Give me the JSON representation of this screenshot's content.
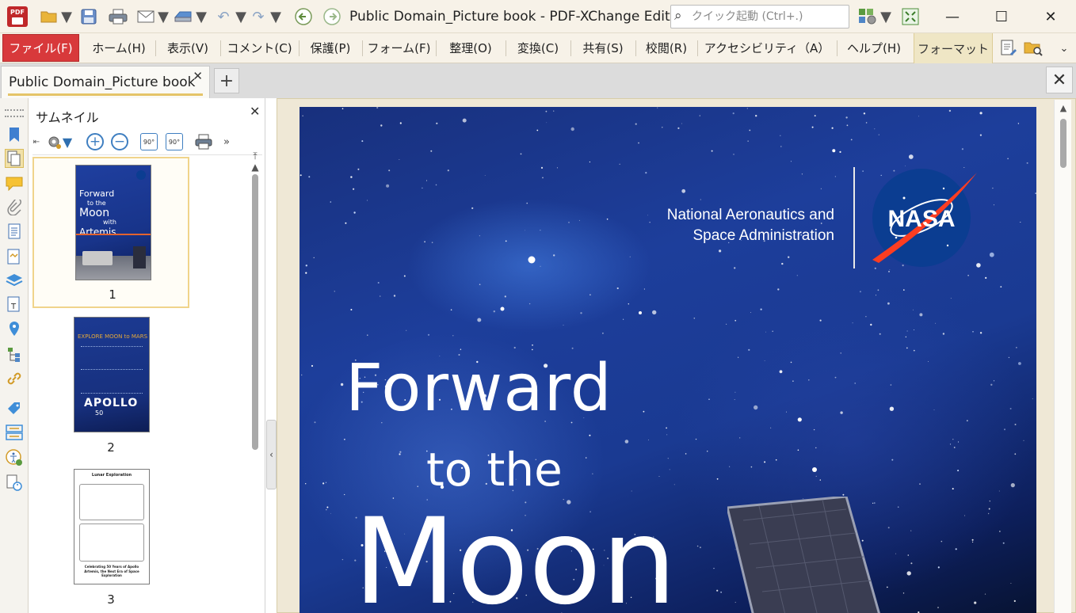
{
  "window": {
    "title": "Public Domain_Picture book - PDF-XChange Editor",
    "quick_launch_placeholder": "クイック起動 (Ctrl+.)",
    "app_icon_label": "PDF"
  },
  "menu": {
    "items": [
      "ファイル(F)",
      "ホーム(H)",
      "表示(V)",
      "コメント(C)",
      "保護(P)",
      "フォーム(F)",
      "整理(O)",
      "変換(C)",
      "共有(S)",
      "校閲(R)",
      "アクセシビリティ（A）",
      "ヘルプ(H)",
      "フォーマット"
    ]
  },
  "tabs": {
    "active": "Public Domain_Picture book"
  },
  "thumbnails": {
    "title": "サムネイル",
    "pages": [
      "1",
      "2",
      "3"
    ],
    "rotate_label": "90°"
  },
  "thumb1": {
    "line1": "Forward",
    "line2": "to the",
    "line3": "Moon",
    "line4": "with",
    "line5": "Artemis"
  },
  "thumb2": {
    "header": "EXPLORE MOON to MARS",
    "logo": "APOLLO",
    "sub": "50"
  },
  "thumb3": {
    "title": "Lunar Exploration",
    "caption1": "Celebrating 50 Years of Apollo",
    "caption2": "Artemis, the Next Era of Space Exploration"
  },
  "document": {
    "org_line1": "National Aeronautics and",
    "org_line2": "Space Administration",
    "logo_text": "NASA",
    "title_line1": "Forward",
    "title_line2": "to the",
    "title_line3": "Moon"
  },
  "colors": {
    "accent_red": "#d8393b",
    "selected_gold": "#f0d48b",
    "chrome_bg": "#f7f2e8",
    "space_blue": "#1d3e9b",
    "nasa_blue": "#0b3d91",
    "nasa_red": "#fc3d21"
  }
}
